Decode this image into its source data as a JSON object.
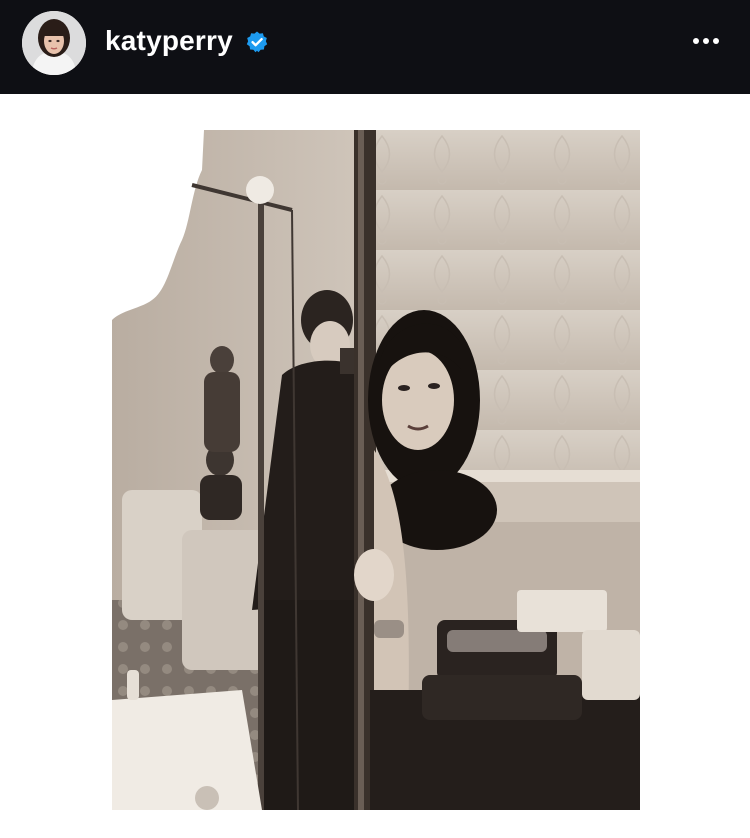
{
  "header": {
    "username": "katyperry",
    "verified": true,
    "icons": {
      "avatar": "profile-avatar",
      "verified": "verified-badge-icon",
      "more": "more-options-icon"
    },
    "colors": {
      "bar_background": "#0e0f14",
      "username": "#ffffff",
      "verified_badge": "#1d9bf0"
    }
  },
  "post": {
    "media": "black-and-white-backstage-photo",
    "background": "#ffffff"
  }
}
